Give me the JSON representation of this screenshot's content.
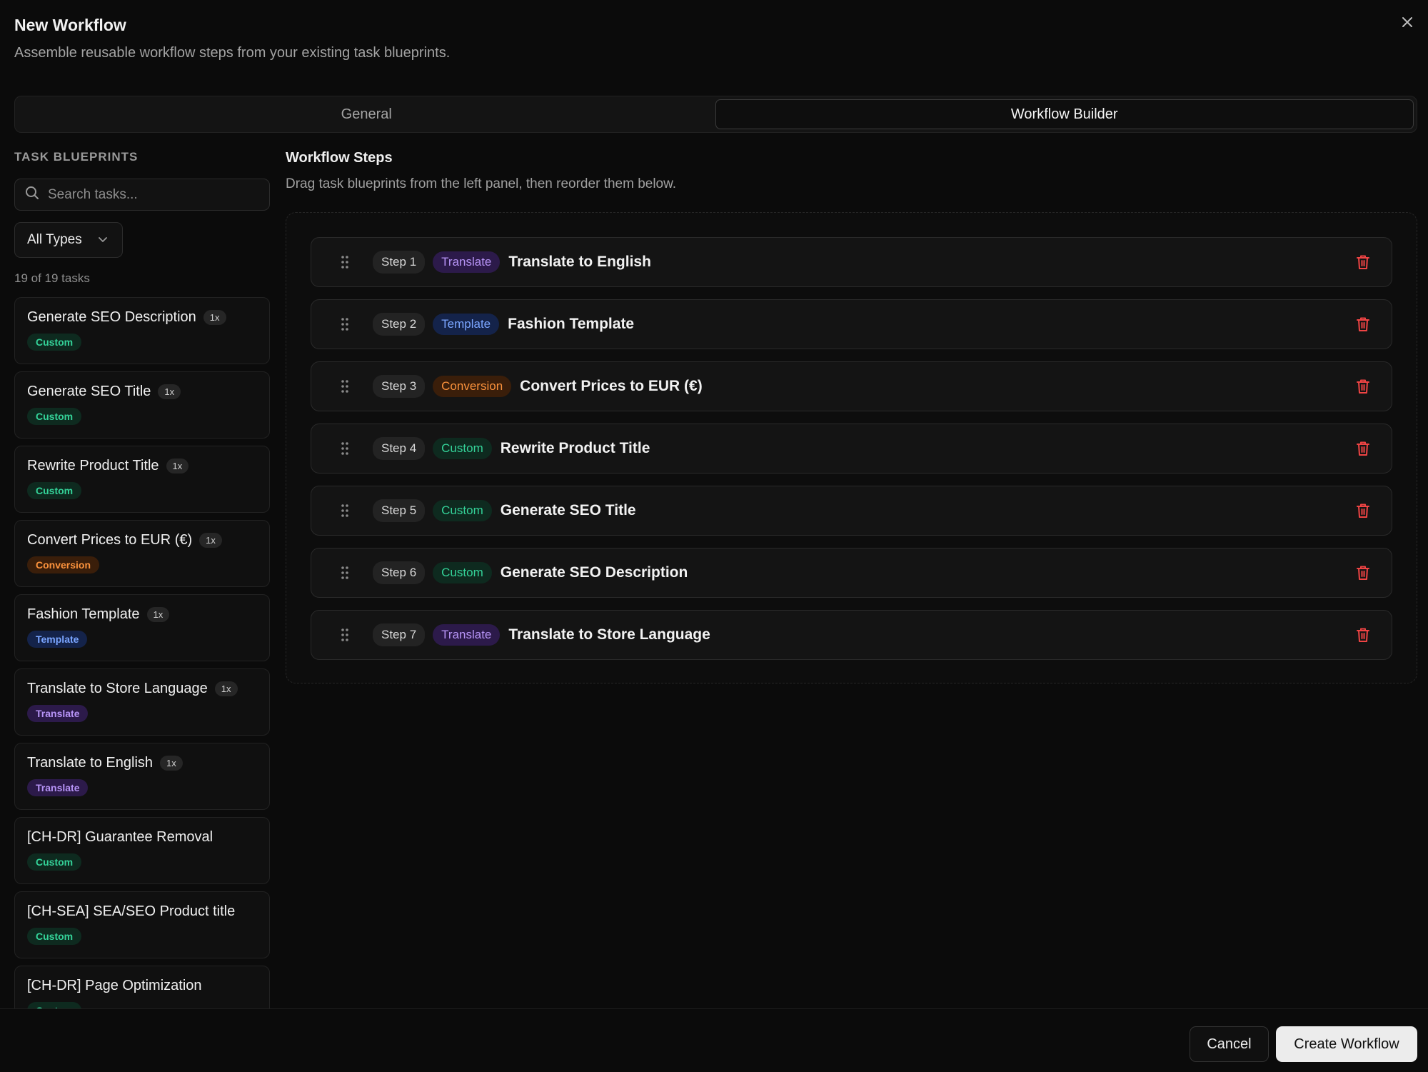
{
  "dialog": {
    "title": "New Workflow",
    "subtitle": "Assemble reusable workflow steps from your existing task blueprints."
  },
  "tabs": [
    {
      "label": "General",
      "active": false
    },
    {
      "label": "Workflow Builder",
      "active": true
    }
  ],
  "blueprints": {
    "section_label": "TASK BLUEPRINTS",
    "search_placeholder": "Search tasks...",
    "filter_label": "All Types",
    "count_text": "19 of 19 tasks",
    "items": [
      {
        "name": "Generate SEO Description",
        "usage": "1x",
        "type": "Custom"
      },
      {
        "name": "Generate SEO Title",
        "usage": "1x",
        "type": "Custom"
      },
      {
        "name": "Rewrite Product Title",
        "usage": "1x",
        "type": "Custom"
      },
      {
        "name": "Convert Prices to EUR (€)",
        "usage": "1x",
        "type": "Conversion"
      },
      {
        "name": "Fashion Template",
        "usage": "1x",
        "type": "Template"
      },
      {
        "name": "Translate to Store Language",
        "usage": "1x",
        "type": "Translate"
      },
      {
        "name": "Translate to English",
        "usage": "1x",
        "type": "Translate"
      },
      {
        "name": "[CH-DR] Guarantee Removal",
        "usage": "",
        "type": "Custom"
      },
      {
        "name": "[CH-SEA] SEA/SEO Product title",
        "usage": "",
        "type": "Custom"
      },
      {
        "name": "[CH-DR] Page Optimization",
        "usage": "",
        "type": "Custom"
      }
    ]
  },
  "workflow": {
    "title": "Workflow Steps",
    "subtitle": "Drag task blueprints from the left panel, then reorder them below.",
    "steps": [
      {
        "step": "Step 1",
        "type": "Translate",
        "name": "Translate to English"
      },
      {
        "step": "Step 2",
        "type": "Template",
        "name": "Fashion Template"
      },
      {
        "step": "Step 3",
        "type": "Conversion",
        "name": "Convert Prices to EUR (€)"
      },
      {
        "step": "Step 4",
        "type": "Custom",
        "name": "Rewrite Product Title"
      },
      {
        "step": "Step 5",
        "type": "Custom",
        "name": "Generate SEO Title"
      },
      {
        "step": "Step 6",
        "type": "Custom",
        "name": "Generate SEO Description"
      },
      {
        "step": "Step 7",
        "type": "Translate",
        "name": "Translate to Store Language"
      }
    ]
  },
  "footer": {
    "cancel_label": "Cancel",
    "create_label": "Create Workflow"
  },
  "colors": {
    "background": "#0b0b0b",
    "custom": "#34d399",
    "conversion": "#fb923c",
    "template": "#7aa5ff",
    "translate": "#b794f6",
    "delete": "#ef4444"
  },
  "icons": {
    "close": "close-icon",
    "search": "search-icon",
    "chevron": "chevron-down-icon",
    "grip": "grip-vertical-icon",
    "trash": "trash-icon"
  }
}
